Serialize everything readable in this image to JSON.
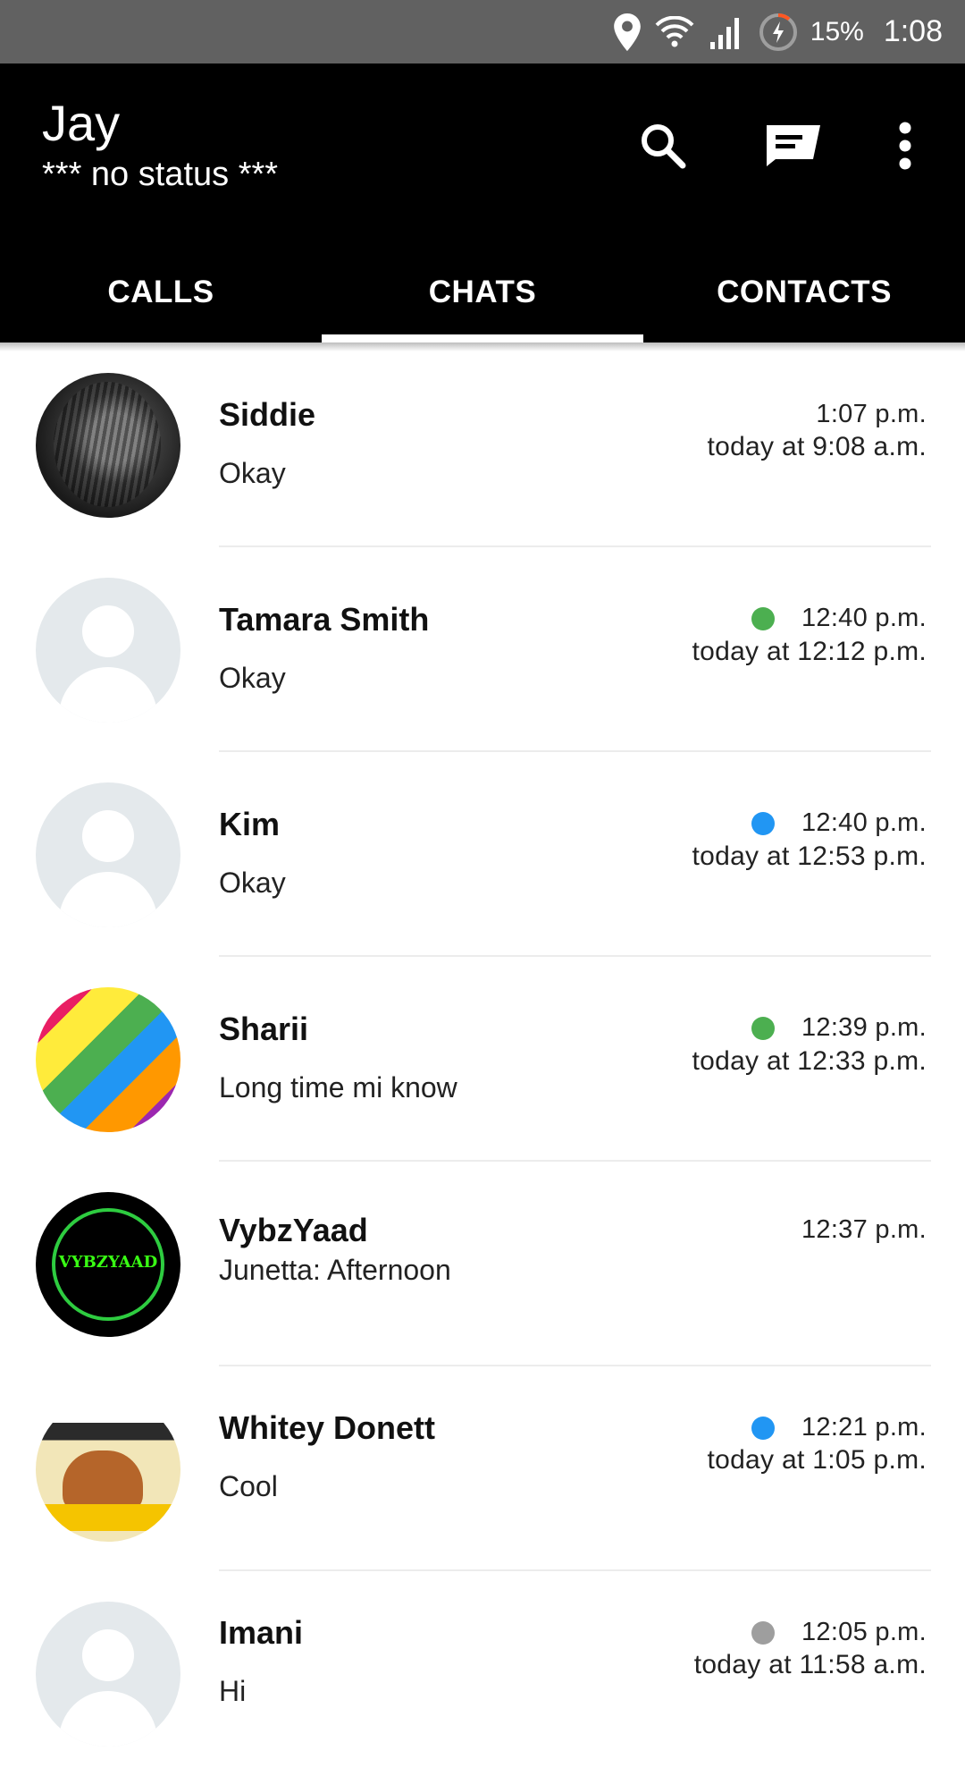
{
  "status_bar": {
    "battery_percent": "15%",
    "time": "1:08",
    "icons": [
      "location-icon",
      "wifi-icon",
      "signal-icon",
      "battery-charging-icon"
    ]
  },
  "header": {
    "user_name": "Jay",
    "user_status": "*** no status ***",
    "actions": [
      "search-icon",
      "compose-icon",
      "more-vert-icon"
    ]
  },
  "tabs": [
    {
      "label": "CALLS",
      "selected": false
    },
    {
      "label": "CHATS",
      "selected": true
    },
    {
      "label": "CONTACTS",
      "selected": false
    }
  ],
  "colors": {
    "appbar": "#000000",
    "status_bar": "#616161",
    "presence_green": "#4caf50",
    "presence_blue": "#2196f3",
    "presence_gray": "#9e9e9e"
  },
  "chats": [
    {
      "name": "Siddie",
      "preview": "Okay",
      "time": "1:07 p.m.",
      "date": "today at 9:08 a.m.",
      "presence": null,
      "avatar": "photo"
    },
    {
      "name": "Tamara Smith",
      "preview": "Okay",
      "time": "12:40 p.m.",
      "date": "today at 12:12 p.m.",
      "presence": "#4caf50",
      "avatar": "placeholder"
    },
    {
      "name": "Kim",
      "preview": "Okay",
      "time": "12:40 p.m.",
      "date": "today at 12:53 p.m.",
      "presence": "#2196f3",
      "avatar": "placeholder"
    },
    {
      "name": "Sharii",
      "preview": "Long time mi know",
      "time": "12:39 p.m.",
      "date": "today at 12:33 p.m.",
      "presence": "#4caf50",
      "avatar": "photo"
    },
    {
      "name": "VybzYaad",
      "preview": "Junetta:  Afternoon",
      "time": "12:37 p.m.",
      "date": "",
      "presence": null,
      "avatar": "logo",
      "avatar_text": "VYBZYAAD"
    },
    {
      "name": "Whitey Donett",
      "preview": "Cool",
      "time": "12:21 p.m.",
      "date": "today at 1:05 p.m.",
      "presence": "#2196f3",
      "avatar": "photo"
    },
    {
      "name": "Imani",
      "preview": "Hi",
      "time": "12:05 p.m.",
      "date": "today at 11:58 a.m.",
      "presence": "#9e9e9e",
      "avatar": "placeholder"
    }
  ]
}
